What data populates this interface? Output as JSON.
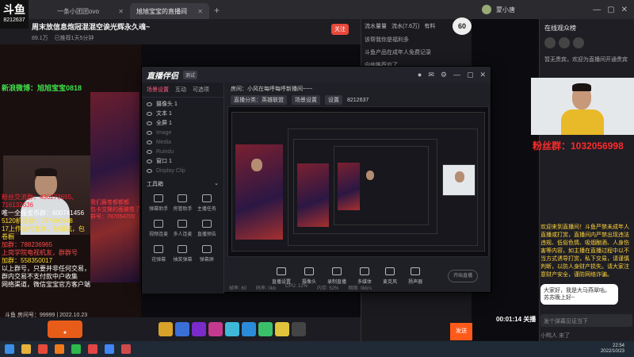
{
  "browser": {
    "corner_title": "斗鱼",
    "corner_sub": "8212637",
    "tabs": [
      {
        "label": "一条小团团ovo"
      },
      {
        "label": "旭旭宝宝的直播间"
      }
    ]
  },
  "room": {
    "title": "周末放信息炮冠混混空诶光辉永久魂~",
    "sub": [
      "89.1万",
      "已推荐1天5分钟"
    ],
    "badge": "关注"
  },
  "stream": {
    "weibo": "新浪微博：旭旭宝宝0818",
    "fans_lines": [
      "粉丝交流群：436273655、716132636",
      "唯一全服金币群：600741456",
      "5120机号群：757490648",
      "17上作业代金群，包漏坑，包卷橱",
      "加群：788236965",
      "上岗学院电视机友，群群号",
      "加群：558350017",
      "以上群号，只要并非任何交易，",
      "群内交易不支付款中户收集",
      "网络渠道，微信宝宝官方客户端"
    ],
    "red_lines": [
      "我们最卷都都都",
      "包卡交换的面被卷了",
      "群号：787054709"
    ],
    "footer": "斗鱼 房间号：99999 | 2022.10.23"
  },
  "mid": {
    "tabs": [
      "流水量量",
      "流水(7.6万)",
      "有料"
    ],
    "rows": [
      "该帮我你是福利多",
      "斗鱼产品在成年人免费记录",
      "向他推荐应了"
    ],
    "speed": "60",
    "time": "00:01:14 关播",
    "orange": "发送"
  },
  "app": {
    "logo": "直播伴侣",
    "tag": "测试",
    "left_tabs": [
      "场景设置",
      "互动",
      "可选项"
    ],
    "scenes": [
      {
        "label": "摄像头 1",
        "dim": false
      },
      {
        "label": "文本 1",
        "dim": false
      },
      {
        "label": "全屏 1",
        "dim": false
      },
      {
        "label": "Image",
        "dim": true
      },
      {
        "label": "Media",
        "dim": true
      },
      {
        "label": "Ruindu",
        "dim": true
      },
      {
        "label": "窗口 1",
        "dim": false
      },
      {
        "label": "Display Clip",
        "dim": true
      }
    ],
    "tools_head": "工具箱",
    "tools": [
      "弹幕助手",
      "房管助手",
      "主播任务",
      "视频连麦",
      "多人连麦",
      "直播预告",
      "花弹幕",
      "抽奖弹幕",
      "弹幕屏"
    ],
    "room_line": "房间：小风在每呼每呼新播间~~~",
    "room_chips": [
      "直播分类：英雄联盟",
      "场景设置",
      "设置"
    ],
    "room_id": "8212637",
    "actions": [
      "直播设置",
      "摄像头",
      "录制直播",
      "多媒体",
      "麦克风",
      "扬声器"
    ],
    "start": "开始直播",
    "status": [
      "帧率: 60",
      "码率: 0kb",
      "CPU: 12%",
      "内存: 52%",
      "网络: 0kb/s"
    ]
  },
  "side": {
    "user": "蒙小唐",
    "title": "在线观众榜",
    "notice": "暂无贵宾，欢迎为直播间开通贵宾",
    "fans_qq": "粉丝群：1032056998",
    "chat_intro": "欢迎来到直播间！斗鱼严禁未成年人直播或打赏，直播间内严禁出现违法违规、低俗色情、吸烟酗酒、人身伤害等内容，如主播在直播过程中以不当方式诱导打赏，私下交易，请谨慎判断，以防人身财产损失。请大家注意财产安全，谨防网络诈骗。",
    "chat_card": "大家好，我是大马燕翠咕。苏苏晚上好~",
    "chat_input": "发个弹幕见证当下",
    "footer": "小鸭人 来了"
  },
  "taskbar": {
    "time": "22:54",
    "date": "2022/10/23"
  }
}
